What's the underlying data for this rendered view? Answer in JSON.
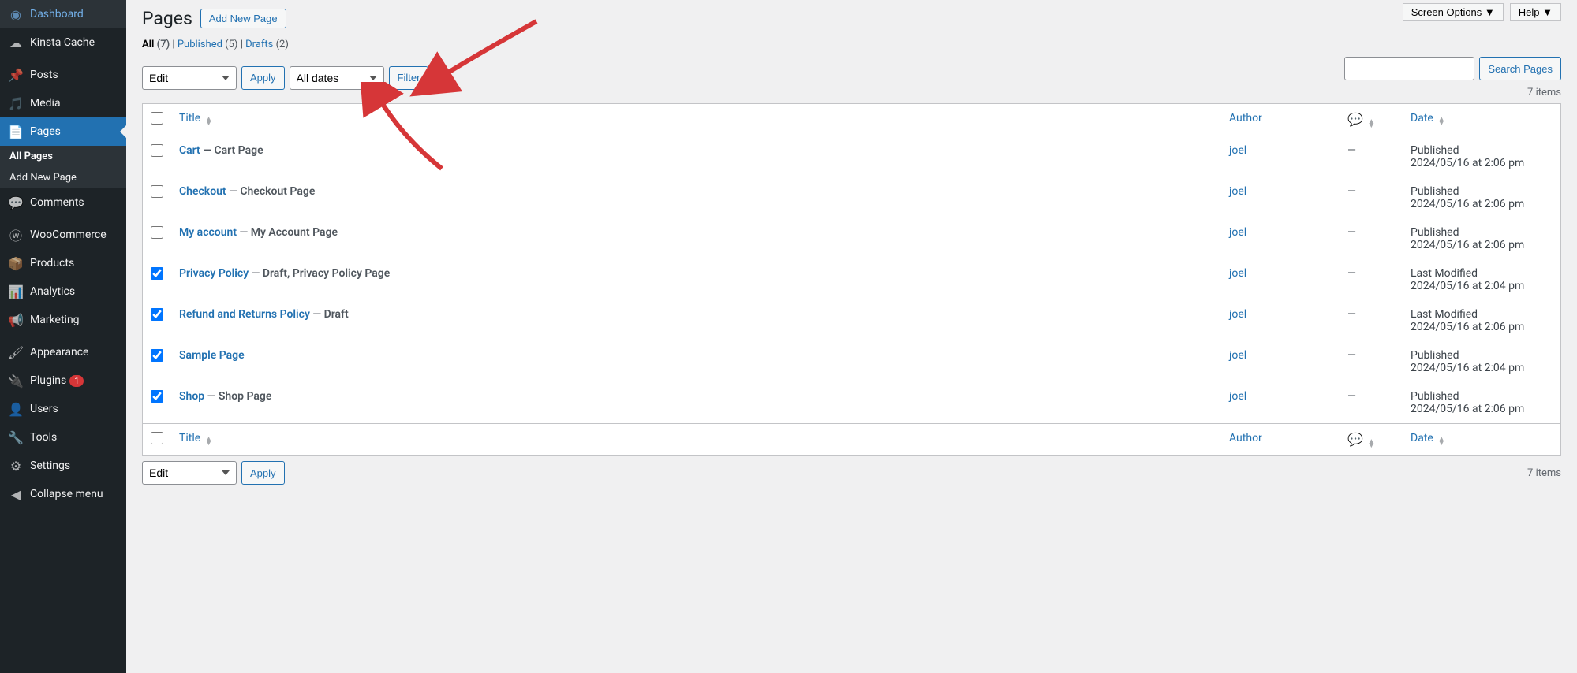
{
  "sidebar": {
    "items": [
      {
        "icon": "dashboard",
        "label": "Dashboard"
      },
      {
        "icon": "cloud",
        "label": "Kinsta Cache"
      },
      {
        "icon": "pin",
        "label": "Posts"
      },
      {
        "icon": "media",
        "label": "Media"
      },
      {
        "icon": "page",
        "label": "Pages",
        "active": true,
        "submenu": [
          {
            "label": "All Pages",
            "current": true
          },
          {
            "label": "Add New Page"
          }
        ]
      },
      {
        "icon": "comment",
        "label": "Comments"
      },
      {
        "icon": "woo",
        "label": "WooCommerce"
      },
      {
        "icon": "products",
        "label": "Products"
      },
      {
        "icon": "analytics",
        "label": "Analytics"
      },
      {
        "icon": "marketing",
        "label": "Marketing"
      },
      {
        "icon": "appearance",
        "label": "Appearance"
      },
      {
        "icon": "plugins",
        "label": "Plugins",
        "badge": "1"
      },
      {
        "icon": "users",
        "label": "Users"
      },
      {
        "icon": "tools",
        "label": "Tools"
      },
      {
        "icon": "settings",
        "label": "Settings"
      },
      {
        "icon": "collapse",
        "label": "Collapse menu"
      }
    ]
  },
  "topbar": {
    "screen_options": "Screen Options ▼",
    "help": "Help ▼"
  },
  "heading": {
    "title": "Pages",
    "add_new": "Add New Page"
  },
  "filters": {
    "all_label": "All",
    "all_count": "(7)",
    "published_label": "Published",
    "published_count": "(5)",
    "drafts_label": "Drafts",
    "drafts_count": "(2)",
    "sep": "  |  "
  },
  "bulk": {
    "action": "Edit",
    "apply": "Apply"
  },
  "datefilter": {
    "value": "All dates",
    "filter": "Filter"
  },
  "search": {
    "placeholder": "",
    "button": "Search Pages"
  },
  "items_count": "7 items",
  "columns": {
    "title": "Title",
    "author": "Author",
    "date": "Date"
  },
  "rows": [
    {
      "checked": false,
      "title": "Cart",
      "suffix": " — Cart Page",
      "author": "joel",
      "comments": "—",
      "status": "Published",
      "date": "2024/05/16 at 2:06 pm"
    },
    {
      "checked": false,
      "title": "Checkout",
      "suffix": " — Checkout Page",
      "author": "joel",
      "comments": "—",
      "status": "Published",
      "date": "2024/05/16 at 2:06 pm"
    },
    {
      "checked": false,
      "title": "My account",
      "suffix": " — My Account Page",
      "author": "joel",
      "comments": "—",
      "status": "Published",
      "date": "2024/05/16 at 2:06 pm"
    },
    {
      "checked": true,
      "title": "Privacy Policy",
      "suffix": " — Draft, Privacy Policy Page",
      "author": "joel",
      "comments": "—",
      "status": "Last Modified",
      "date": "2024/05/16 at 2:04 pm"
    },
    {
      "checked": true,
      "title": "Refund and Returns Policy",
      "suffix": " — Draft",
      "author": "joel",
      "comments": "—",
      "status": "Last Modified",
      "date": "2024/05/16 at 2:06 pm"
    },
    {
      "checked": true,
      "title": "Sample Page",
      "suffix": "",
      "author": "joel",
      "comments": "—",
      "status": "Published",
      "date": "2024/05/16 at 2:04 pm"
    },
    {
      "checked": true,
      "title": "Shop",
      "suffix": " — Shop Page",
      "author": "joel",
      "comments": "—",
      "status": "Published",
      "date": "2024/05/16 at 2:06 pm"
    }
  ]
}
